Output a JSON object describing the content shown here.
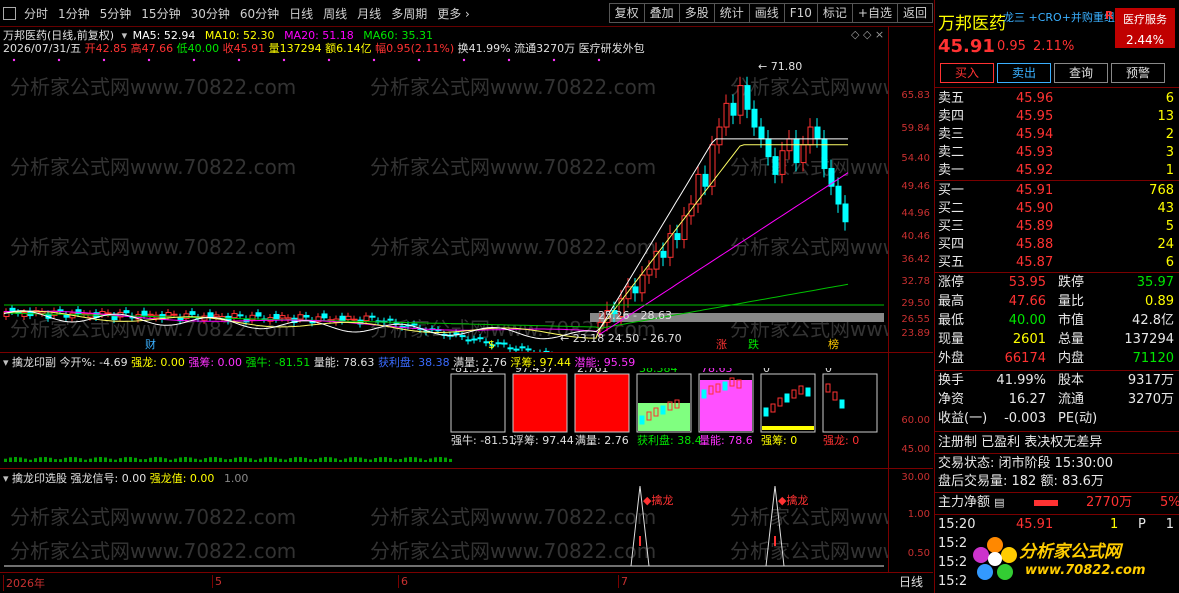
{
  "toolbar": {
    "close_icon": "close-icon",
    "periods": [
      "分时",
      "1分钟",
      "5分钟",
      "15分钟",
      "30分钟",
      "60分钟",
      "日线",
      "周线",
      "月线",
      "多周期",
      "更多 ›"
    ],
    "buttons": [
      "复权",
      "叠加",
      "多股",
      "统计",
      "画线",
      "F10",
      "标记",
      "+自选",
      "返回"
    ]
  },
  "main_chart": {
    "title": "万邦医药(日线,前复权)",
    "ma": {
      "ma5": "MA5: 52.94",
      "ma10": "MA10: 52.30",
      "ma20": "MA20: 51.18",
      "ma60": "MA60: 35.31"
    },
    "info_date": "2026/07/31/五",
    "info_open": "开42.85",
    "info_high": "高47.66",
    "info_low": "低40.00",
    "info_close": "收45.91",
    "info_vol": "量137294",
    "info_amt": "额6.14亿",
    "info_amp": "幅0.95(2.11%)",
    "info_turn": "换41.99%",
    "info_float": "流通3270万",
    "info_concept": "医疗研发外包",
    "peak_label": "71.80",
    "low_label1": "25.26 - 28.63",
    "low_label2": "23.18 24.50 - 26.70",
    "markers": [
      "财",
      "$",
      "涨",
      "跌",
      "榜"
    ],
    "yticks": [
      "65.83",
      "59.84",
      "54.40",
      "49.46",
      "44.96",
      "40.46",
      "36.42",
      "32.78",
      "29.50",
      "26.55",
      "23.89"
    ],
    "watermark": "分析家公式网www.70822.com"
  },
  "sub1": {
    "title": "擒龙印副",
    "kaicang": "今开%: -4.69",
    "qianglong": "强龙: 0.00",
    "qiangchou": "强筹: 0.00",
    "qiangniu": "强牛: -81.51",
    "liangneng": "量能: 78.63",
    "huolipan": "获利盘: 38.38",
    "manliang": "满量: 2.76",
    "fuchou": "浮筹: 97.44",
    "qianneng": "潜能: 95.59",
    "box_values": [
      "-81.511",
      "97.437",
      "2.761",
      "38.384",
      "78.63",
      "0",
      "0"
    ],
    "box_labels": [
      "强牛: -81.51",
      "浮筹: 97.44",
      "满量: 2.76",
      "获利盘: 38.4",
      "量能: 78.6",
      "强筹: 0",
      "强龙: 0"
    ],
    "yticks": [
      "60.00",
      "45.00",
      "30.00"
    ]
  },
  "sub2": {
    "title": "擒龙印选股",
    "signal": "强龙信号: 0.00",
    "value": "强龙值: 0.00",
    "extra": "1.00",
    "signal_label": "擒龙",
    "yticks": [
      "1.00",
      "0.50"
    ]
  },
  "date_axis": {
    "labels": [
      "2026年",
      "5",
      "6",
      "7"
    ],
    "period": "日线"
  },
  "quote": {
    "name": "万邦医药",
    "tags": "龙三 +CRO+并购重组",
    "r_mark": "R",
    "service": "医疗服务",
    "service_pct": "2.44%",
    "price": "45.91",
    "change": "0.95",
    "change_pct": "2.11%",
    "actions": [
      "买入",
      "卖出",
      "查询",
      "预警"
    ],
    "sell": [
      {
        "label": "卖五",
        "price": "45.96",
        "vol": "6"
      },
      {
        "label": "卖四",
        "price": "45.95",
        "vol": "13"
      },
      {
        "label": "卖三",
        "price": "45.94",
        "vol": "2"
      },
      {
        "label": "卖二",
        "price": "45.93",
        "vol": "3"
      },
      {
        "label": "卖一",
        "price": "45.92",
        "vol": "1"
      }
    ],
    "buy": [
      {
        "label": "买一",
        "price": "45.91",
        "vol": "768"
      },
      {
        "label": "买二",
        "price": "45.90",
        "vol": "43"
      },
      {
        "label": "买三",
        "price": "45.89",
        "vol": "5"
      },
      {
        "label": "买四",
        "price": "45.88",
        "vol": "24"
      },
      {
        "label": "买五",
        "price": "45.87",
        "vol": "6"
      }
    ],
    "stats": [
      {
        "l": "涨停",
        "v": "53.95",
        "l2": "跌停",
        "v2": "35.97"
      },
      {
        "l": "最高",
        "v": "47.66",
        "l2": "量比",
        "v2": "0.89"
      },
      {
        "l": "最低",
        "v": "40.00",
        "l2": "市值",
        "v2": "42.8亿"
      },
      {
        "l": "现量",
        "v": "2601",
        "l2": "总量",
        "v2": "137294"
      },
      {
        "l": "外盘",
        "v": "66174",
        "l2": "内盘",
        "v2": "71120"
      }
    ],
    "stats2": [
      {
        "l": "换手",
        "v": "41.99%",
        "l2": "股本",
        "v2": "9317万"
      },
      {
        "l": "净资",
        "v": "16.27",
        "l2": "流通",
        "v2": "3270万"
      },
      {
        "l": "收益(一)",
        "v": "-0.003",
        "l2": "PE(动)",
        "v2": ""
      }
    ],
    "note": "注册制 已盈利 表决权无差异",
    "trade_status": "交易状态: 闭市阶段 15:30:00",
    "after_hours": "盘后交易量: 182  额: 83.6万",
    "main_flow_label": "主力净额",
    "main_flow_value": "2770万",
    "main_flow_pct": "5%",
    "ticks": [
      {
        "t": "15:20",
        "p": "45.91",
        "v": "1",
        "s": "P",
        "n": "1"
      },
      {
        "t": "15:2",
        "p": "",
        "v": "",
        "s": "",
        "n": ""
      },
      {
        "t": "15:2",
        "p": "",
        "v": "",
        "s": "",
        "n": ""
      },
      {
        "t": "15:2",
        "p": "",
        "v": "",
        "s": "",
        "n": ""
      }
    ],
    "logo_text": "分析家公式网",
    "logo_url": "www.70822.com"
  }
}
